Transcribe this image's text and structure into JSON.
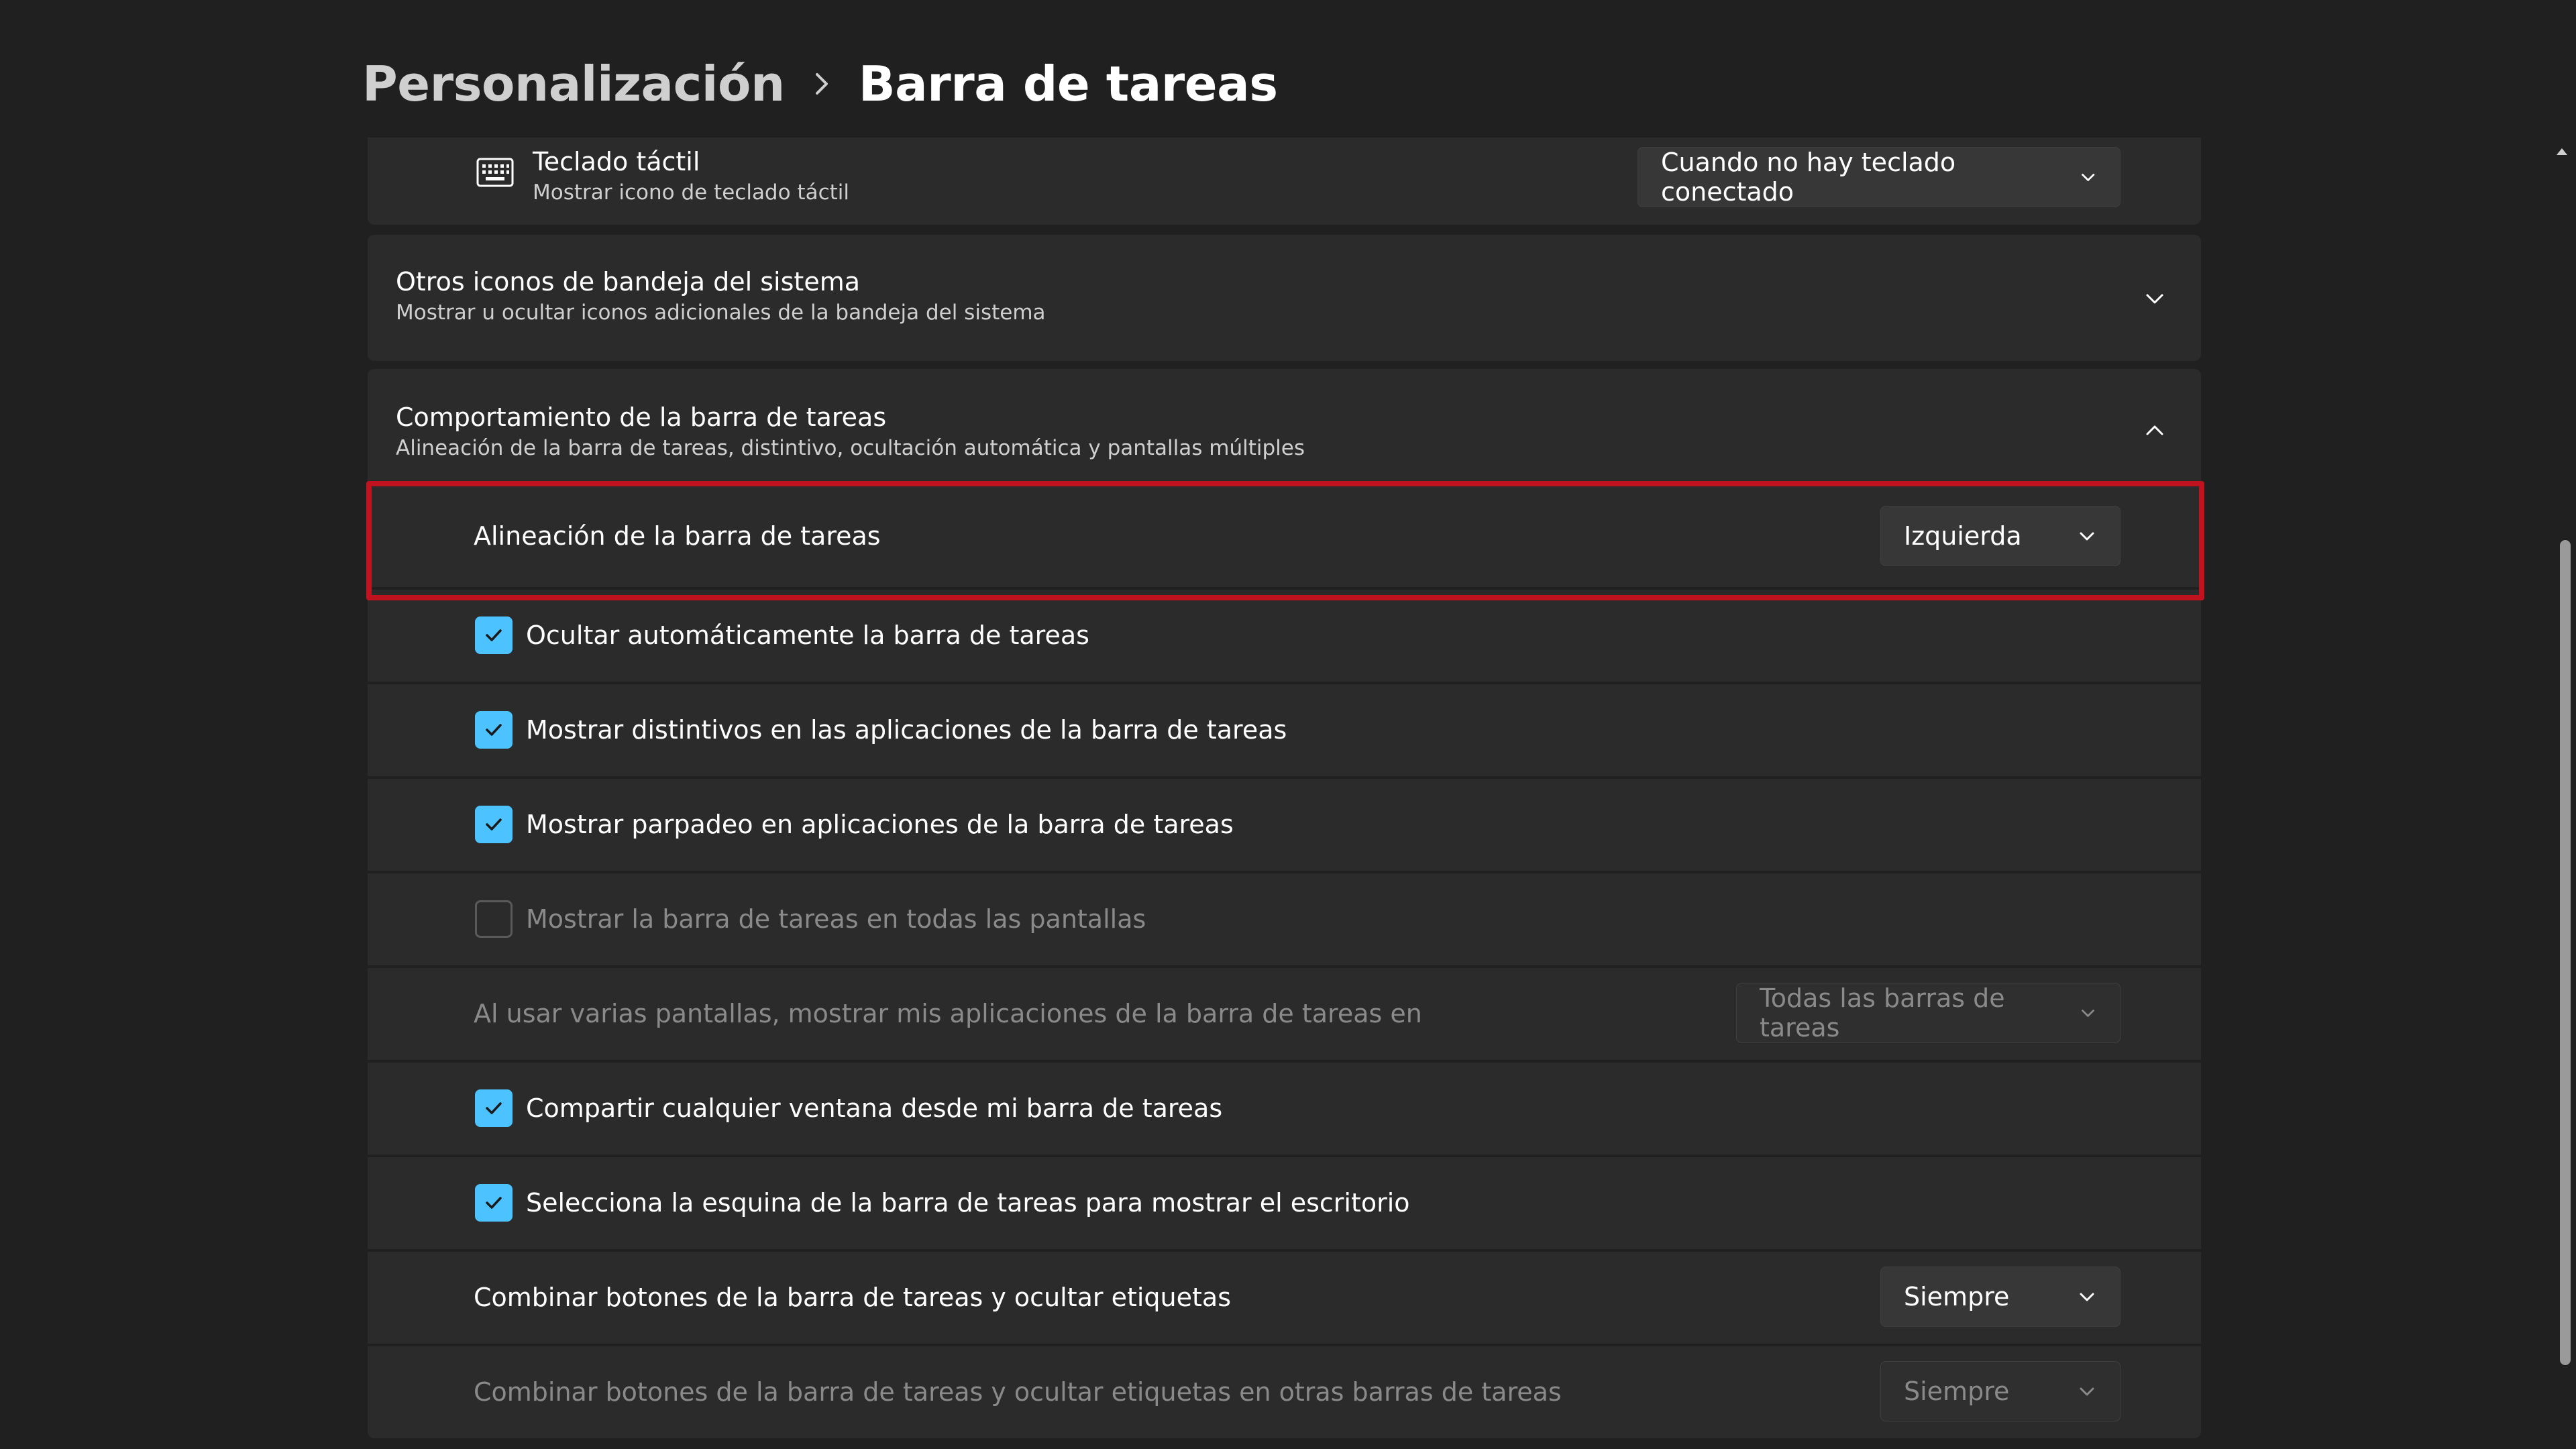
{
  "breadcrumb": {
    "parent": "Personalización",
    "current": "Barra de tareas"
  },
  "touch_keyboard": {
    "title": "Teclado táctil",
    "subtitle": "Mostrar icono de teclado táctil",
    "value": "Cuando no hay teclado conectado",
    "icon": "keyboard-icon"
  },
  "tray_icons": {
    "title": "Otros iconos de bandeja del sistema",
    "subtitle": "Mostrar u ocultar iconos adicionales de la bandeja del sistema"
  },
  "behaviors": {
    "title": "Comportamiento de la barra de tareas",
    "subtitle": "Alineación de la barra de tareas, distintivo, ocultación automática y pantallas múltiples",
    "alignment": {
      "label": "Alineación de la barra de tareas",
      "value": "Izquierda"
    },
    "autohide": {
      "label": "Ocultar automáticamente la barra de tareas",
      "checked": true
    },
    "badges": {
      "label": "Mostrar distintivos en las aplicaciones de la barra de tareas",
      "checked": true
    },
    "flashing": {
      "label": "Mostrar parpadeo en aplicaciones de la barra de tareas",
      "checked": true
    },
    "all_displays": {
      "label": "Mostrar la barra de tareas en todas las pantallas",
      "checked": false
    },
    "multi_display": {
      "label": "Al usar varias pantallas, mostrar mis aplicaciones de la barra de tareas en",
      "value": "Todas las barras de tareas"
    },
    "share_window": {
      "label": "Compartir cualquier ventana desde mi barra de tareas",
      "checked": true
    },
    "far_corner": {
      "label": "Selecciona la esquina de la barra de tareas para mostrar el escritorio",
      "checked": true
    },
    "combine": {
      "label": "Combinar botones de la barra de tareas y ocultar etiquetas",
      "value": "Siempre"
    },
    "combine_other": {
      "label": "Combinar botones de la barra de tareas y ocultar etiquetas en otras barras de tareas",
      "value": "Siempre"
    }
  },
  "colors": {
    "accent": "#4cc2ff",
    "highlight": "#c1121f",
    "background": "#202020",
    "card": "#2b2b2b"
  }
}
